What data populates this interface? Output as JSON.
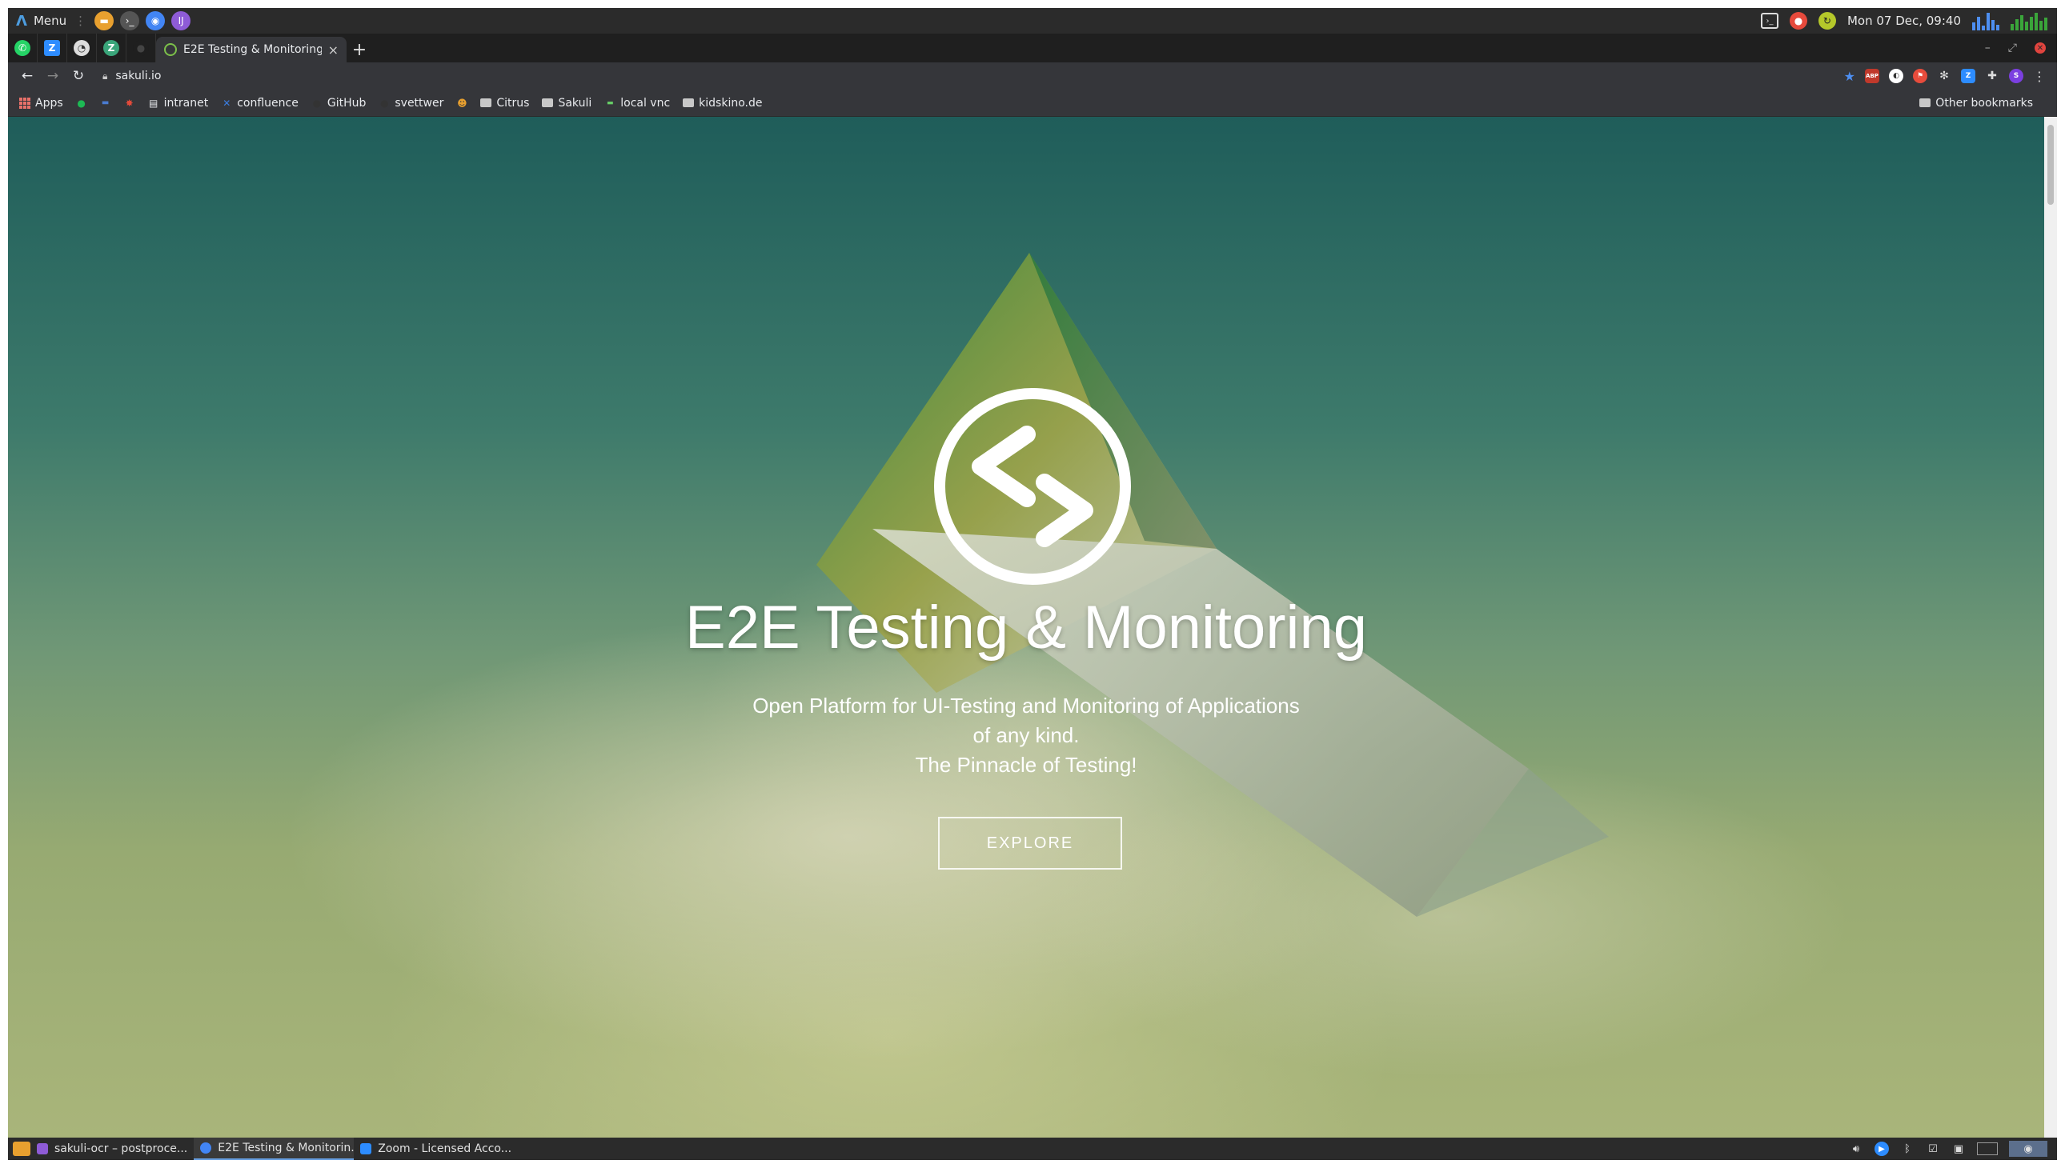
{
  "panel": {
    "menu_label": "Menu",
    "datetime": "Mon 07 Dec, 09:40",
    "cpu_bars": [
      40,
      70,
      25,
      90,
      55,
      30
    ],
    "net_bars": [
      35,
      60,
      80,
      45,
      70,
      90,
      50,
      65
    ]
  },
  "tabs": {
    "active_title": "E2E Testing & Monitoring",
    "new_tab": "+",
    "close": "×"
  },
  "toolbar": {
    "url": "sakuli.io"
  },
  "bookmarks": {
    "items": [
      {
        "label": "Apps"
      },
      {
        "label": "intranet"
      },
      {
        "label": "confluence"
      },
      {
        "label": "GitHub"
      },
      {
        "label": "svettwer"
      },
      {
        "label": "Citrus"
      },
      {
        "label": "Sakuli"
      },
      {
        "label": "local vnc"
      },
      {
        "label": "kidskino.de"
      }
    ],
    "other": "Other bookmarks"
  },
  "hero": {
    "title": "E2E Testing & Monitoring",
    "subtitle_line1": "Open Platform for UI-Testing and Monitoring of Applications",
    "subtitle_line2": "of any kind.",
    "subtitle_line3": "The Pinnacle of Testing!",
    "cta": "EXPLORE"
  },
  "taskbar": {
    "tasks": [
      {
        "label": "sakuli-ocr – postproce..."
      },
      {
        "label": "E2E Testing & Monitorin..."
      },
      {
        "label": "Zoom - Licensed Acco..."
      }
    ]
  },
  "colors": {
    "accent": "#6aa0e0",
    "hero_text": "#ffffff",
    "sky_top": "#1f5d5a",
    "meadow": "#a9b57a"
  }
}
